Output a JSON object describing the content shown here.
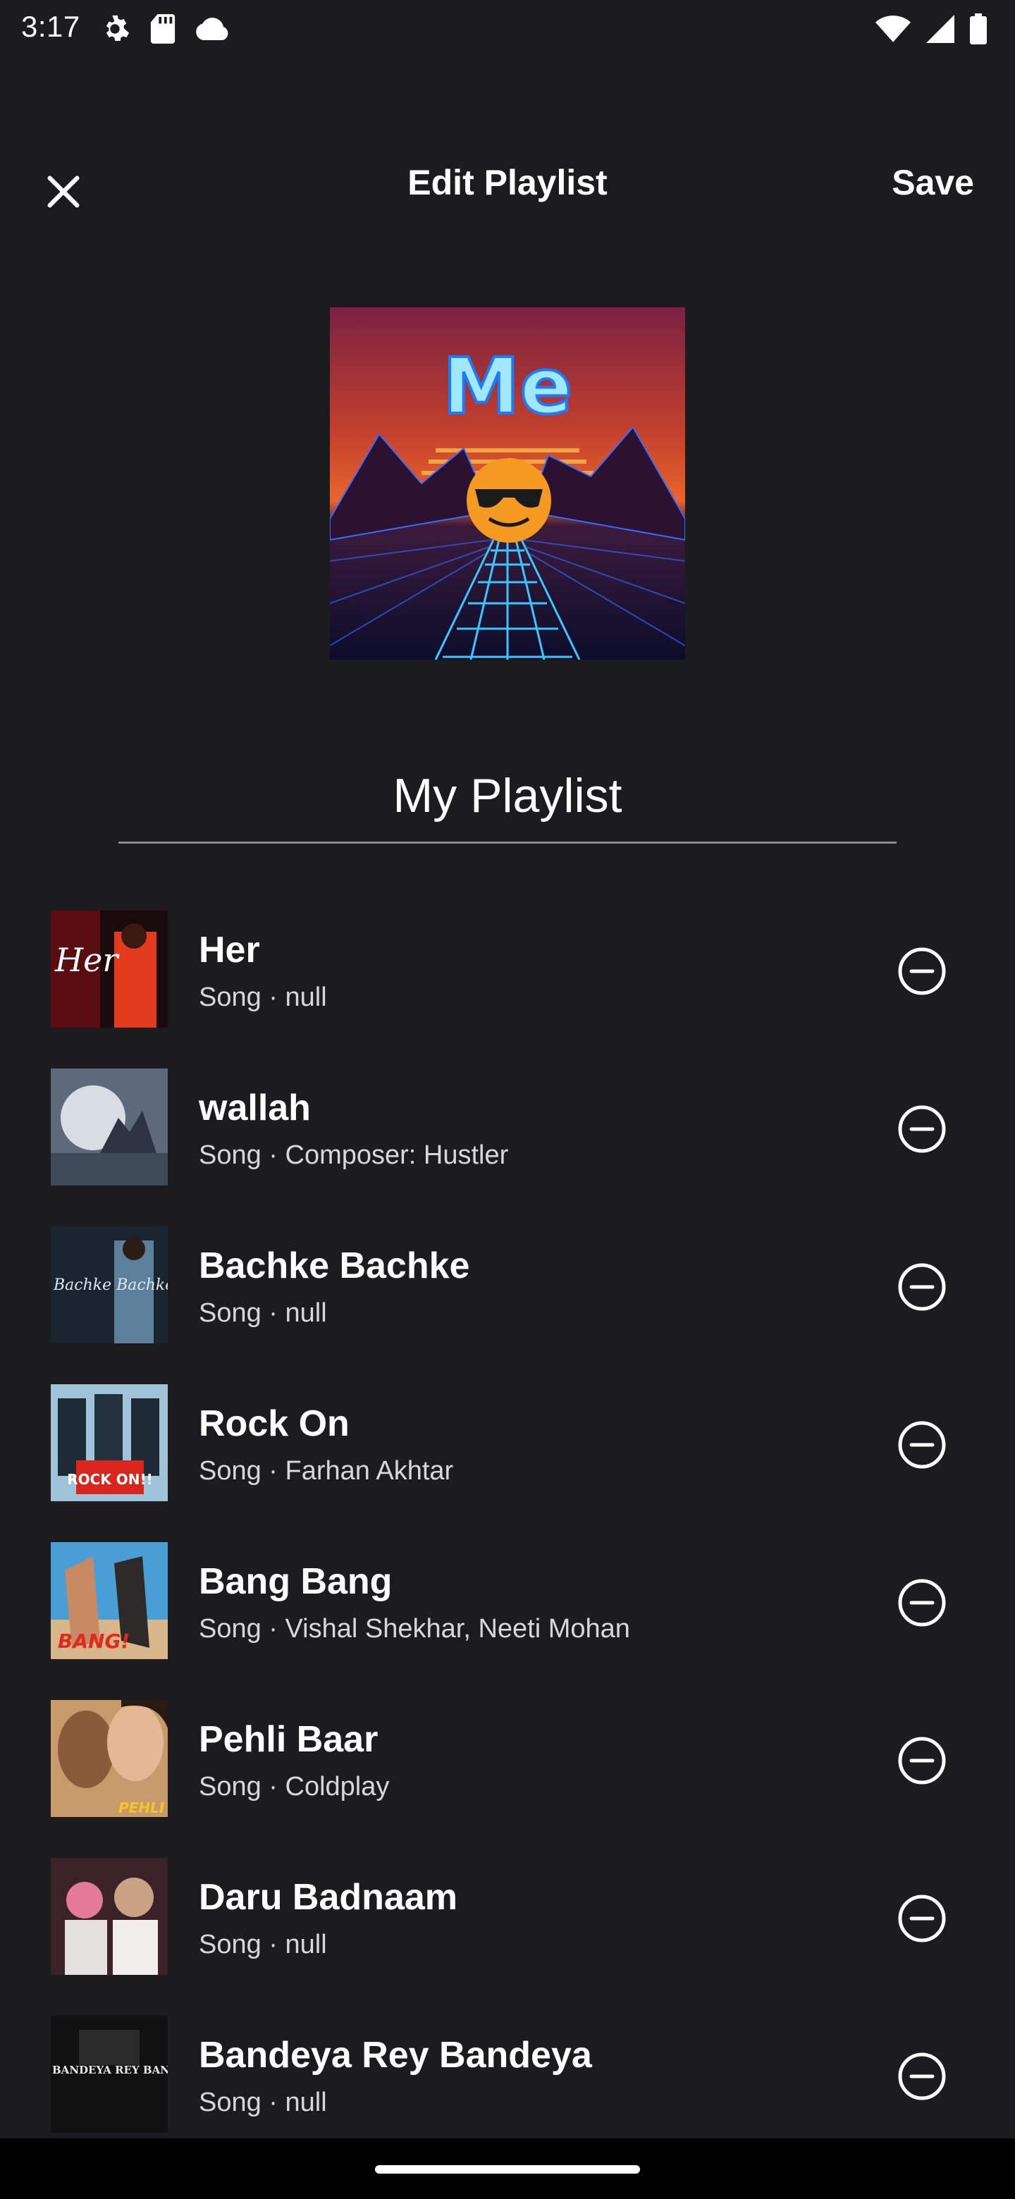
{
  "status_bar": {
    "time": "3:17",
    "left_icons": [
      "settings-icon",
      "sd-card-icon",
      "cloud-icon"
    ],
    "right_icons": [
      "wifi-icon",
      "signal-icon",
      "battery-icon"
    ]
  },
  "header": {
    "close_icon": "close-icon",
    "title": "Edit Playlist",
    "save_label": "Save"
  },
  "cover": {
    "text": "Me",
    "description_colors": {
      "accent": "#f4a32a",
      "grid": "#3aa6ff"
    }
  },
  "playlist_name": {
    "value": "My Playlist"
  },
  "tracks": [
    {
      "title": "Her",
      "subtitle": "Song · null",
      "thumb_text": "Her"
    },
    {
      "title": "wallah",
      "subtitle": "Song · Composer: Hustler",
      "thumb_text": ""
    },
    {
      "title": "Bachke Bachke",
      "subtitle": "Song · null",
      "thumb_text": "Bachke Bachke"
    },
    {
      "title": "Rock On",
      "subtitle": "Song · Farhan Akhtar",
      "thumb_text": "ROCK ON!!"
    },
    {
      "title": "Bang Bang",
      "subtitle": "Song · Vishal Shekhar, Neeti Mohan",
      "thumb_text": "BANG!"
    },
    {
      "title": "Pehli Baar",
      "subtitle": "Song · Coldplay",
      "thumb_text": "PEHLI BAA"
    },
    {
      "title": "Daru Badnaam",
      "subtitle": "Song · null",
      "thumb_text": ""
    },
    {
      "title": "Bandeya Rey Bandeya",
      "subtitle": "Song · null",
      "thumb_text": "BANDEYA REY BANDEY"
    }
  ],
  "colors": {
    "background": "#1c1c1f",
    "text": "#ffffff",
    "subtext": "#d8d8dc",
    "divider": "#8a8a8d"
  }
}
